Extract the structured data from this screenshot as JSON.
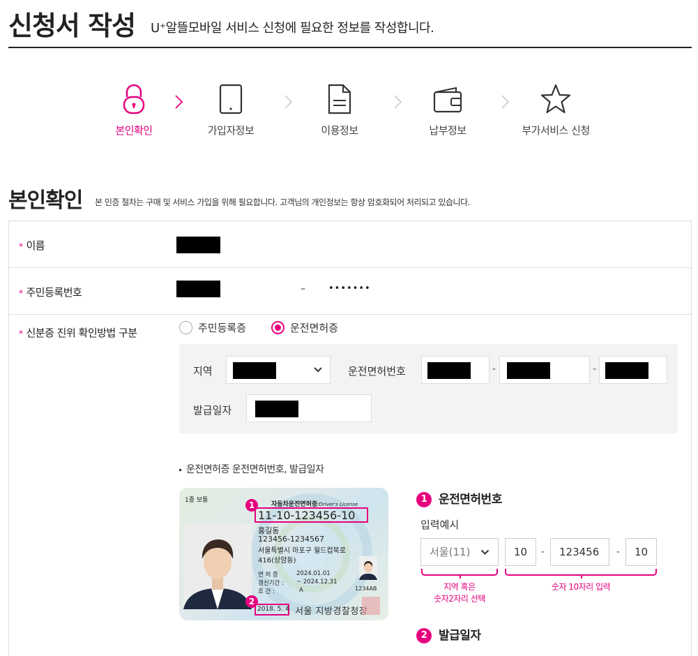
{
  "header": {
    "title": "신청서 작성",
    "subtitle": "U⁺알뜰모바일 서비스 신청에 필요한 정보를 작성합니다."
  },
  "steps": [
    {
      "label": "본인확인",
      "icon": "lock-icon",
      "active": true
    },
    {
      "label": "가입자정보",
      "icon": "phone-icon",
      "active": false
    },
    {
      "label": "이용정보",
      "icon": "document-icon",
      "active": false
    },
    {
      "label": "납부정보",
      "icon": "wallet-icon",
      "active": false
    },
    {
      "label": "부가서비스 신청",
      "icon": "star-icon",
      "active": false
    }
  ],
  "section": {
    "title": "본인확인",
    "desc": "본 인증 절차는 구매 및 서비스 가입을 위해 필요합니다. 고객님의 개인정보는 항상 암호화되어 처리되고 있습니다."
  },
  "form": {
    "required_mark": "*",
    "name_label": "이름",
    "rrn_label": "주민등록번호",
    "rrn_dash": "–",
    "rrn_back": "•••••••",
    "idtype_label": "신분증 진위 확인방법 구분",
    "radio_options": [
      "주민등록증",
      "운전면허증"
    ],
    "radio_selected": "운전면허증",
    "region_label": "지역",
    "license_label": "운전면허번호",
    "issue_label": "발급일자",
    "dash": "-"
  },
  "guide": {
    "note": "운전면허증 운전면허번호, 발급일자",
    "card": {
      "type": "1종 보통",
      "header": "자동차운전면허증",
      "header_en": "/Driver's License",
      "number": "11-10-123456-10",
      "name": "홍길동",
      "rrn": "123456-1234567",
      "addr1": "서울특별시 마포구 월드컵북로",
      "addr2": "416(상암동)",
      "test_label": "면 허 증",
      "test_date": "2024.01.01",
      "renew_label": "갱신기간 :",
      "renew_date": "~ 2024.12.31",
      "cond_label": "조    건 :",
      "cond_val": "A",
      "code": "1234AB",
      "issue": "2018. 5. 4",
      "issuer": "서울 지방경찰청장",
      "num1": "1",
      "num2": "2"
    },
    "ex1_num": "1",
    "ex1_title": "운전면허번호",
    "ex_sub": "입력예시",
    "ex_region": "서울(11)",
    "ex_parts": [
      "10",
      "123456",
      "10"
    ],
    "ex_dash": "-",
    "ex_note1": "지역 혹은\n숫자2자리 선택",
    "ex_note2": "숫자 10자리 입력",
    "ex2_num": "2",
    "ex2_title": "발급일자"
  },
  "colors": {
    "accent": "#e6007e",
    "text": "#222222",
    "gray_bg": "#f3f3f3"
  }
}
